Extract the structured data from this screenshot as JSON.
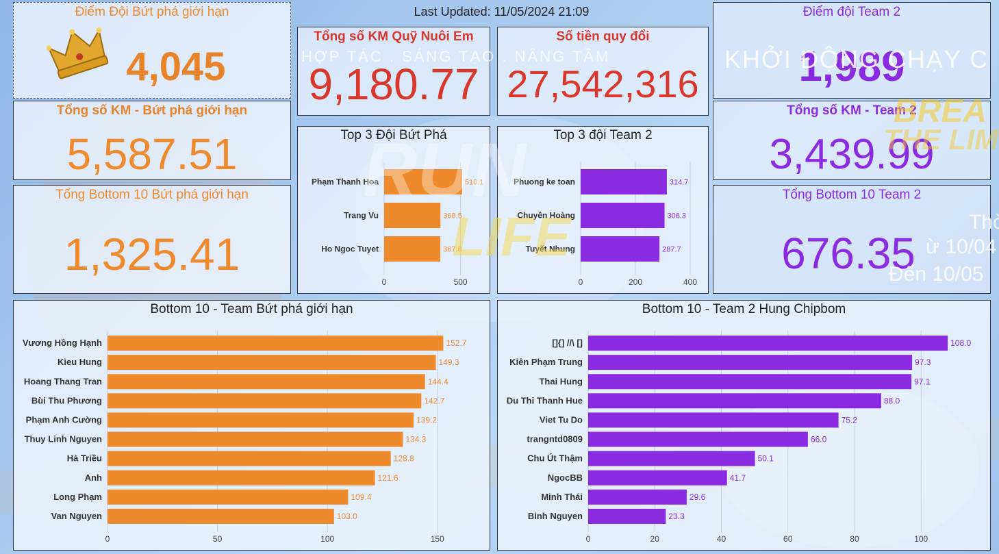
{
  "header": {
    "last_updated": "Last Updated: 11/05/2024 21:09"
  },
  "cards": {
    "points_team1": {
      "title": "Điểm Đội Bứt phá giới hạn",
      "value": "4,045"
    },
    "km_team1": {
      "title": "Tổng số KM - Bứt phá giới hạn",
      "value": "5,587.51"
    },
    "bottom10_team1": {
      "title": "Tổng Bottom 10 Bứt phá giới hạn",
      "value": "1,325.41"
    },
    "total_km_fund": {
      "title": "Tổng số KM Quỹ Nuôi Em",
      "value": "9,180.77"
    },
    "money": {
      "title": "Số tiền quy đổi",
      "value": "27,542,316"
    },
    "points_team2": {
      "title": "Điểm đội Team 2",
      "value": "1,989"
    },
    "km_team2": {
      "title": "Tổng số KM - Team 2",
      "value": "3,439.99"
    },
    "bottom10_team2": {
      "title": "Tổng Bottom 10 Team 2",
      "value": "676.35"
    }
  },
  "background_text": {
    "tagline": "HỢP TÁC . SÁNG TẠO . NÂNG TẦM",
    "khoi_dong": "KHỞI ĐỘNG CHẠY C",
    "run": "RUN",
    "life": "LIFE",
    "break": "BREA",
    "the_lim": "THE LIM",
    "tho": "Thờ",
    "date1": "ừ 10/04",
    "date2": "Đến 10/05"
  },
  "colors": {
    "orange": "#ee8a2c",
    "purple": "#8a2be2",
    "red": "#d8372c"
  },
  "chart_data": [
    {
      "id": "top3_team1",
      "type": "bar",
      "orientation": "horizontal",
      "title": "Top 3 Đội Bứt Phá",
      "categories": [
        "Phạm Thanh Hoa",
        "Trang Vu",
        "Ho Ngoc Tuyet"
      ],
      "values": [
        510.1,
        368.5,
        367.8
      ],
      "xlim": [
        0,
        560
      ],
      "xticks": [
        0,
        500
      ],
      "color": "#ee8a2c"
    },
    {
      "id": "top3_team2",
      "type": "bar",
      "orientation": "horizontal",
      "title": "Top 3 đội Team 2",
      "categories": [
        "Phuong ke toan",
        "Chuyên Hoàng",
        "Tuyết Nhung"
      ],
      "values": [
        314.7,
        306.3,
        287.7
      ],
      "xlim": [
        0,
        420
      ],
      "xticks": [
        0,
        200,
        400
      ],
      "color": "#8a2be2"
    },
    {
      "id": "bottom10_team1",
      "type": "bar",
      "orientation": "horizontal",
      "title": "Bottom 10 - Team Bứt phá giới hạn",
      "categories": [
        "Vương Hồng Hạnh",
        "Kieu Hung",
        "Hoang Thang Tran",
        "Bùi Thu Phương",
        "Phạm Anh Cường",
        "Thuy Linh Nguyen",
        "Hà Triều",
        "Anh",
        "Long Phạm",
        "Van Nguyen"
      ],
      "values": [
        152.7,
        149.3,
        144.4,
        142.7,
        139.2,
        134.3,
        128.8,
        121.6,
        109.4,
        103.0
      ],
      "xlim": [
        0,
        170
      ],
      "xticks": [
        0,
        50,
        100,
        150
      ],
      "color": "#ee8a2c"
    },
    {
      "id": "bottom10_team2",
      "type": "bar",
      "orientation": "horizontal",
      "title": "Bottom 10 - Team 2 Hung Chipbom",
      "categories": [
        "[]{] //\\ []",
        "Kiên Phạm Trung",
        "Thai Hung",
        "Du Thi Thanh Hue",
        "Viet Tu Do",
        "trangntd0809",
        "Chu Út Thậm",
        "NgocBB",
        "Minh Thái",
        "Binh Nguyen"
      ],
      "values": [
        108.0,
        97.3,
        97.1,
        88.0,
        75.2,
        66.0,
        50.1,
        41.7,
        29.6,
        23.3
      ],
      "xlim": [
        0,
        116
      ],
      "xticks": [
        0,
        20,
        40,
        60,
        80,
        100
      ],
      "color": "#8a2be2"
    }
  ]
}
